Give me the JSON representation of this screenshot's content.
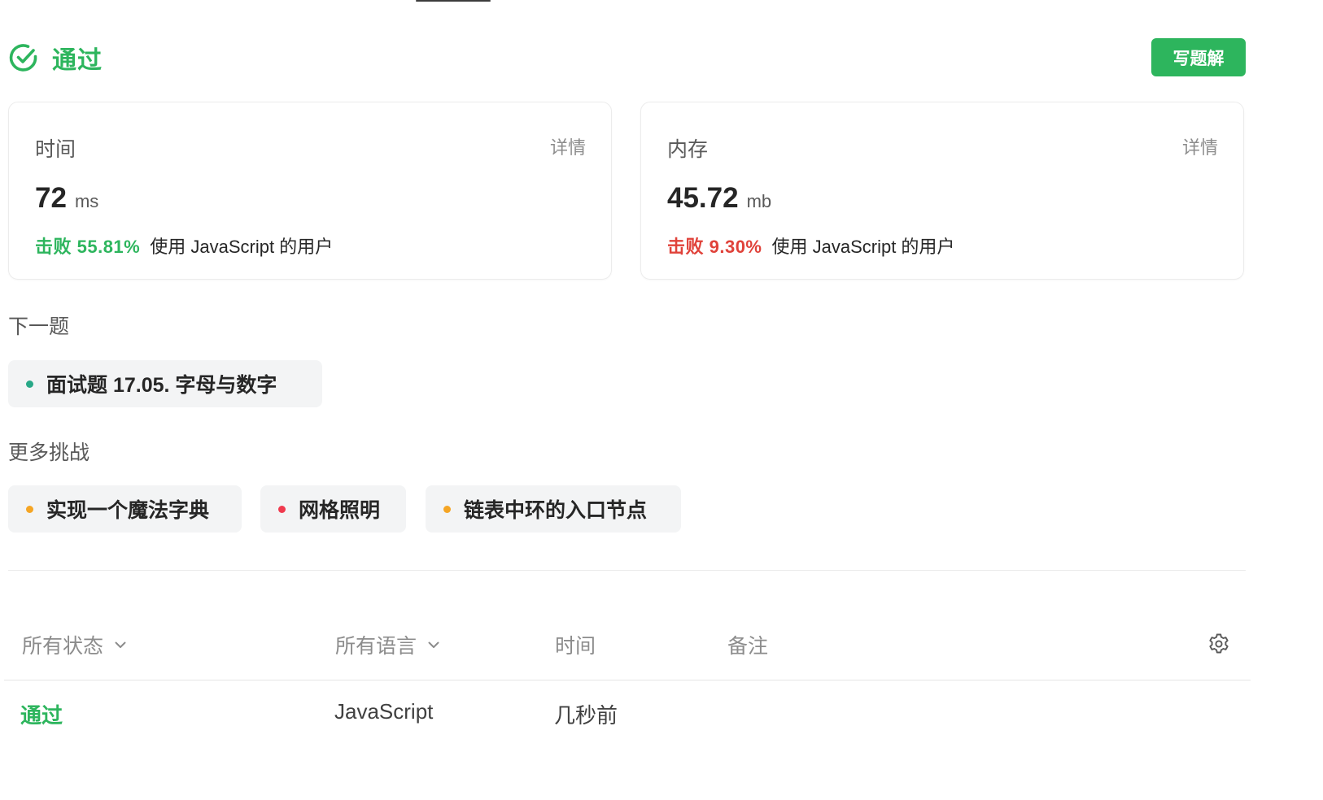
{
  "header": {
    "status": "通过",
    "write_solution_button": "写题解"
  },
  "stats": {
    "time": {
      "label": "时间",
      "detail": "详情",
      "value": "72",
      "unit": "ms",
      "beats": "击败 55.81%",
      "beats_suffix": "使用 JavaScript 的用户"
    },
    "memory": {
      "label": "内存",
      "detail": "详情",
      "value": "45.72",
      "unit": "mb",
      "beats": "击败 9.30%",
      "beats_suffix": "使用 JavaScript 的用户"
    }
  },
  "next_problem": {
    "title": "下一题",
    "item": {
      "label": "面试题 17.05. 字母与数字",
      "difficulty_color": "#28a887"
    }
  },
  "more_challenges": {
    "title": "更多挑战",
    "items": [
      {
        "label": "实现一个魔法字典",
        "difficulty_color": "#f5a524"
      },
      {
        "label": "网格照明",
        "difficulty_color": "#f03a4e"
      },
      {
        "label": "链表中环的入口节点",
        "difficulty_color": "#f5a524"
      }
    ]
  },
  "submissions": {
    "columns": {
      "status_filter": "所有状态",
      "language_filter": "所有语言",
      "time": "时间",
      "notes": "备注"
    },
    "rows": [
      {
        "status": "通过",
        "language": "JavaScript",
        "time": "几秒前",
        "notes": ""
      }
    ]
  },
  "colors": {
    "accent_green": "#2db55d",
    "fail_red": "#e0423a"
  },
  "icons": {
    "status": "check-circle-icon",
    "dropdown": "chevron-down-icon",
    "settings": "gear-icon"
  }
}
